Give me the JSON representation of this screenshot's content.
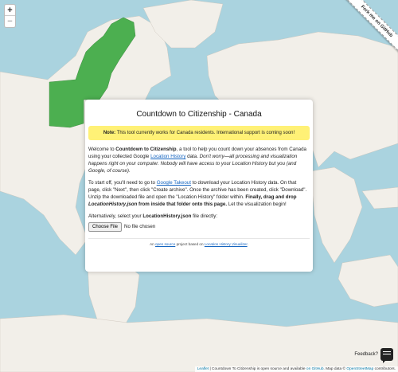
{
  "map": {
    "land_color": "#f2efe9",
    "water_color": "#aad3df",
    "highlight_color": "#4caf50",
    "zoom_in_label": "+",
    "zoom_out_label": "−"
  },
  "ribbon": {
    "label": "Fork me on GitHub"
  },
  "card": {
    "title": "Countdown to Citizenship - Canada",
    "note_strong": "Note:",
    "note_text": " This tool currently works for Canada residents. International support is coming soon!",
    "intro_1": "Welcome to ",
    "intro_app_name": "Countdown to Citizenship",
    "intro_2": ", a tool to help you count down your absences from Canada using your collected Google ",
    "intro_link": "Location History",
    "intro_3": " data. ",
    "intro_italic": "Don't worry—all processing and visualization happens right on your computer. Nobody will have access to your Location History but you (and Google, of course).",
    "steps_1": "To start off, you'll need to go to ",
    "steps_link": "Google Takeout",
    "steps_2": " to download your Location History data. On that page, click \"Next\", then click \"Create archive\". Once the archive has been created, click \"Download\". Unzip the downloaded file and open the \"Location History\" folder within. ",
    "steps_bold_1": "Finally, drag and drop ",
    "steps_bold_italic": "LocationHistory.json",
    "steps_bold_2": " from inside that folder onto this page.",
    "steps_3": " Let the visualization begin!",
    "alt_1": "Alternatively, select your ",
    "alt_bold": "LocationHistory.json",
    "alt_2": " file directly:",
    "choose_file": "Choose File",
    "no_file": "No file chosen",
    "footer_1": "An ",
    "footer_link_1": "open source",
    "footer_2": " project based on ",
    "footer_link_2": "Location History Visualizer",
    "footer_3": "."
  },
  "feedback": {
    "label": "Feedback?"
  },
  "attribution": {
    "leaflet": "Leaflet",
    "text_1": " | Countdown To Citizenship is open source and available ",
    "link_1": "on GitHub",
    "text_2": ". Map data © ",
    "link_2": "OpenStreetMap",
    "text_3": " contributors."
  }
}
